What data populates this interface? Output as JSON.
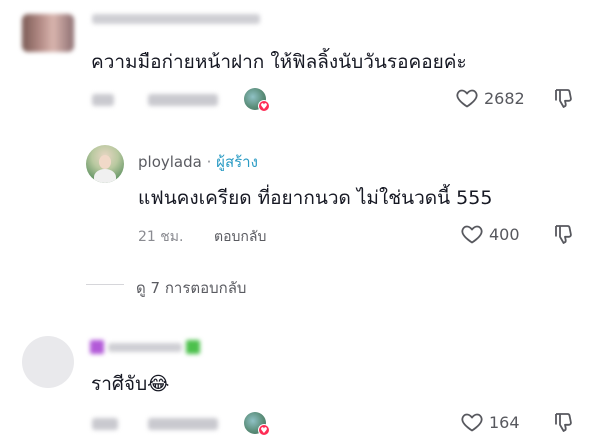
{
  "comments": [
    {
      "text": "ความมือก่ายหน้าฝาก ให้ฟิลลิ้งนับวันรอคอยค่ะ",
      "likes": "2682",
      "replies": [
        {
          "username": "ploylada",
          "separator": "·",
          "badge": "ผู้สร้าง",
          "text": "แฟนคงเครียด ที่อยากนวด ไม่ใช่นวดนี้ 555",
          "time": "21 ชม.",
          "reply_label": "ตอบกลับ",
          "likes": "400"
        }
      ],
      "view_replies_label": "ดู 7 การตอบกลับ"
    },
    {
      "text": "ราศีจับ😂",
      "likes": "164"
    }
  ],
  "icons": {
    "like": "heart-outline-icon",
    "dislike": "thumbs-down-icon",
    "creator_liked": "heart-badge-icon",
    "chevron": "chevron-down-icon"
  },
  "colors": {
    "badge": "#2a9bc4",
    "text": "#161823",
    "muted": "#8a8b91",
    "heart_badge": "#fe2c55"
  }
}
